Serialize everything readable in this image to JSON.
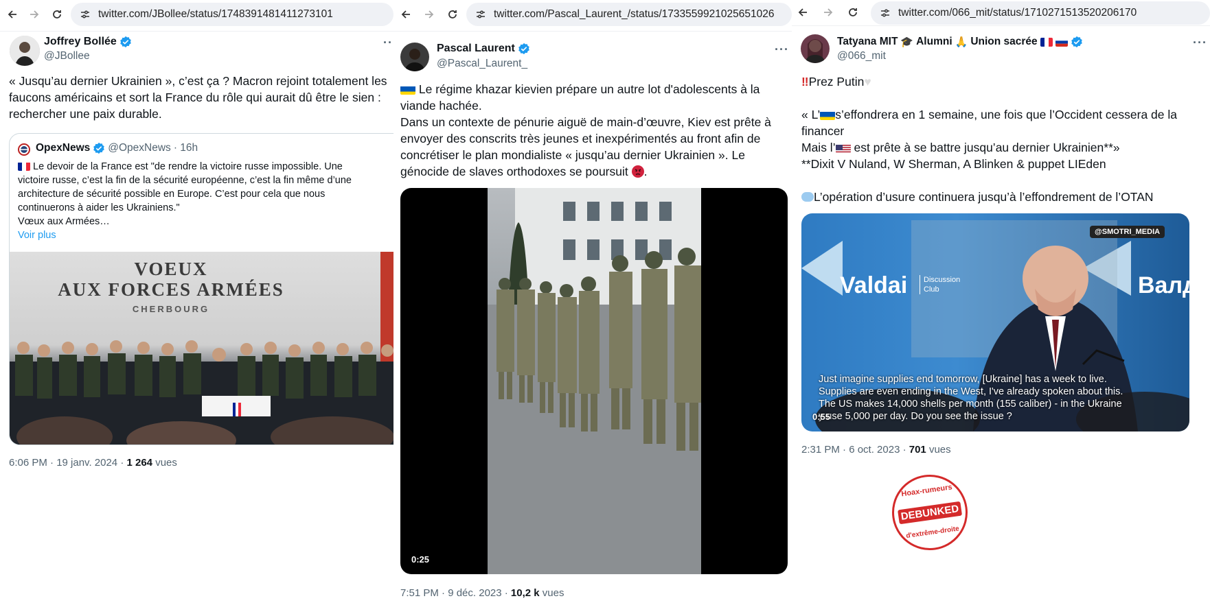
{
  "panels": [
    {
      "url": "twitter.com/JBollee/status/1748391481411273101",
      "author": {
        "name": "Joffrey Bollée",
        "handle": "@JBollee"
      },
      "text": [
        "« Jusqu’au dernier Ukrainien », c’est ça ? Macron rejoint totalement les",
        "faucons américains et sort la France du rôle qui aurait dû être le sien :",
        "rechercher une paix durable."
      ],
      "quote": {
        "name": "OpexNews",
        "handle": "@OpexNews",
        "time": "· 16h",
        "text": [
          "Le devoir de la France est \"de rendre la victoire russe impossible. Une",
          "victoire russe, c’est la fin de la sécurité européenne, c’est la fin même d’une",
          "architecture de sécurité possible en Europe. C’est pour cela que nous",
          "continuerons à aider les Ukrainiens.\"",
          "Vœux aux Armées…"
        ],
        "more": "Voir plus",
        "image_text": {
          "line1": "VOEUX",
          "line2": "AUX FORCES ARMÉES",
          "line3": "CHERBOURG"
        }
      },
      "meta": {
        "time": "6:06 PM · 19 janv. 2024 · ",
        "views": "1 264",
        "views_label": " vues"
      }
    },
    {
      "url": "twitter.com/Pascal_Laurent_/status/1733559921025651026",
      "author": {
        "name": "Pascal Laurent",
        "handle": "@Pascal_Laurent_"
      },
      "text": [
        " Le régime khazar kievien prépare un autre lot d'adolescents à la",
        "viande hachée.",
        "Dans un contexte de pénurie aiguë de main-d’œuvre, Kiev est prête à",
        "envoyer des conscrits très jeunes et inexpérimentés au front afin de",
        "concrétiser le plan mondialiste « jusqu’au dernier Ukrainien ». Le",
        "génocide de slaves orthodoxes se poursuit "
      ],
      "text_end": ".",
      "video": {
        "duration": "0:25"
      },
      "meta": {
        "time": "7:51 PM · 9 déc. 2023 · ",
        "views": "10,2 k",
        "views_label": " vues"
      }
    },
    {
      "url": "twitter.com/066_mit/status/1710271513520206170",
      "author": {
        "name": "Tatyana MIT",
        "name_suffix": " Alumni ",
        "name_suffix2": "Union sacrée",
        "handle": "@066_mit"
      },
      "text_line1": "Prez Putin",
      "text_q1a": "« L’",
      "text_q1b": "s’effondrera en 1 semaine, une fois que l’Occident cessera de la",
      "text_q2": "financer",
      "text_q3a": "Mais l’",
      "text_q3b": " est prête à se battre jusqu’au dernier Ukrainien**»",
      "text_q4": "**Dixit V Nuland, W Sherman, A Blinken & puppet LIEden",
      "text_q5": "L’opération d’usure continuera jusqu’à l’effondrement de l’OTAN",
      "video": {
        "watermark": "@SMOTRI_MEDIA",
        "valdai": "Valdai",
        "discussion": "Discussion",
        "club": "Club",
        "valdai_ru": "Валдa",
        "subtitles": [
          "Just imagine supplies end tomorrow, [Ukraine] has a week to live.",
          "Supplies are even ending in the West, I've already spoken about this.",
          "The US makes 14,000 shells per month (155 caliber) - in the Ukraine",
          "y use 5,000 per day. Do you see the issue ?"
        ],
        "duration": "0:55"
      },
      "meta": {
        "time": "2:31 PM · 6 oct. 2023 · ",
        "views": "701",
        "views_label": " vues"
      },
      "stamp": {
        "top": "Hoax-rumeurs",
        "middle": "DEBUNKED",
        "bottom": "d'extrême-droite"
      }
    }
  ],
  "colors": {
    "verified": "#1d9bf0",
    "link": "#1d9bf0",
    "stamp": "#d42a2a"
  }
}
